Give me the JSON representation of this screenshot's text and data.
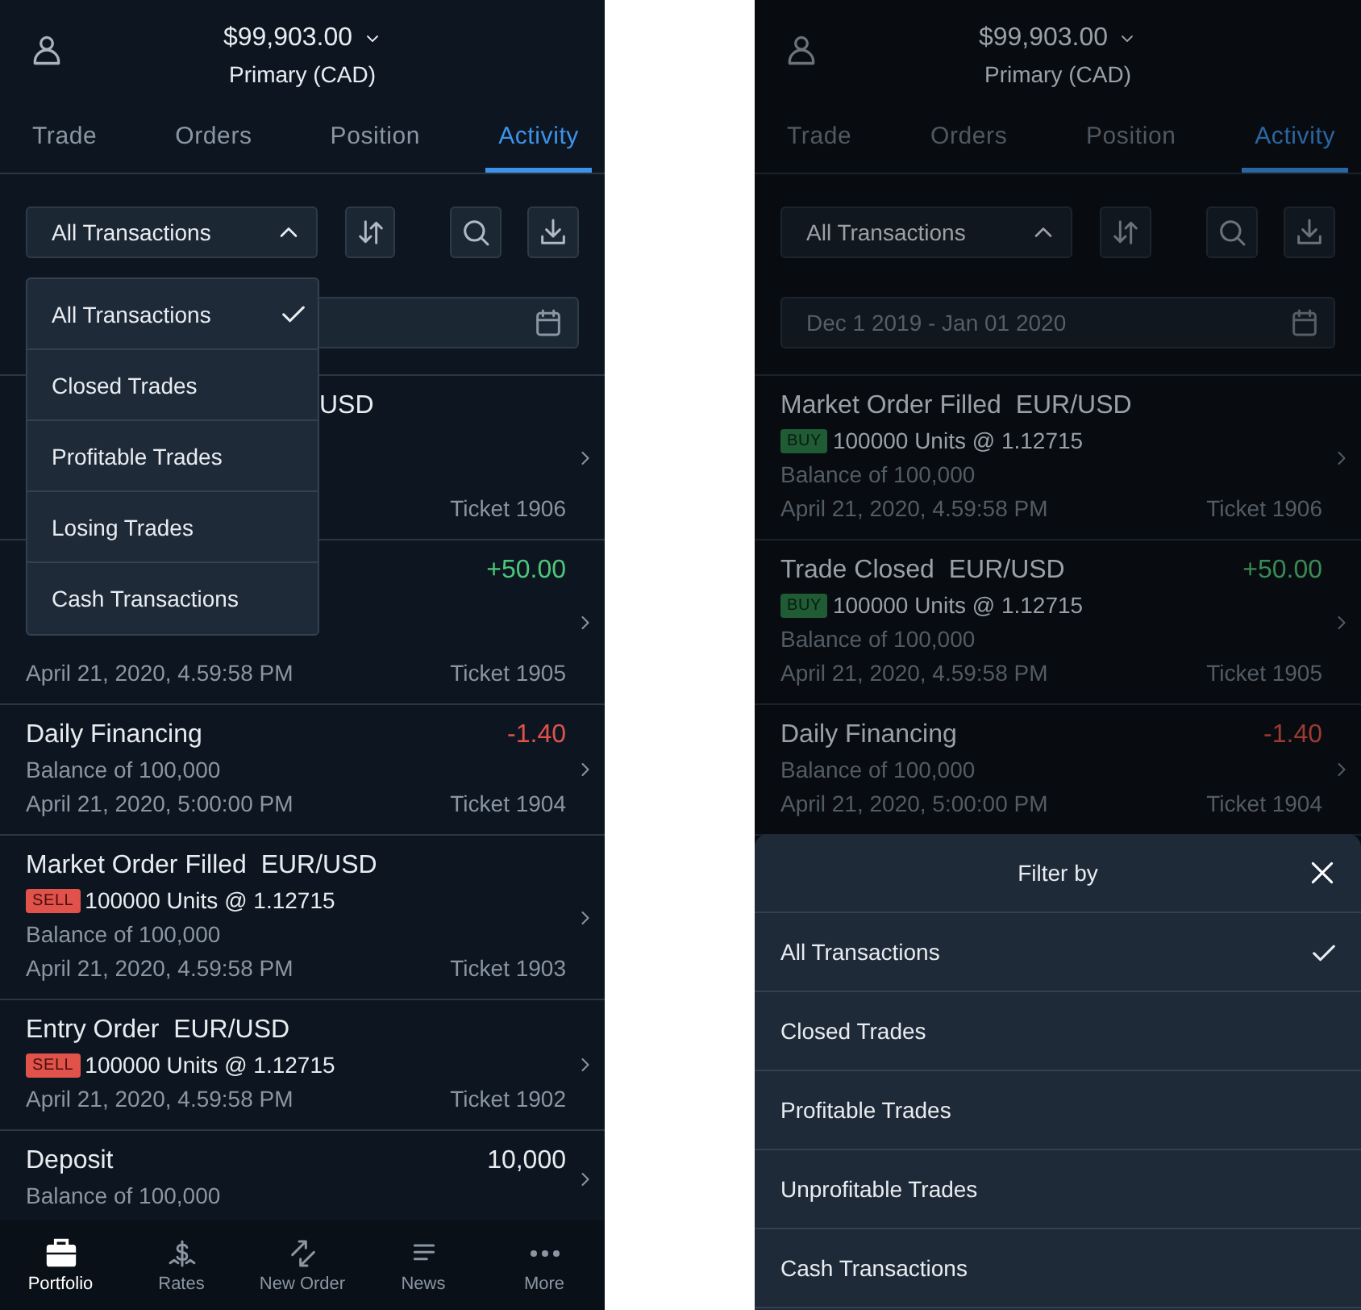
{
  "left_screen": {
    "header": {
      "balance": "$99,903.00",
      "account": "Primary (CAD)"
    },
    "tabs": [
      {
        "label": "Trade",
        "selected": false
      },
      {
        "label": "Orders",
        "selected": false
      },
      {
        "label": "Position",
        "selected": false
      },
      {
        "label": "Activity",
        "selected": true
      }
    ],
    "filter": {
      "value": "All Transactions",
      "expanded": true
    },
    "dropdown": {
      "options": [
        {
          "label": "All Transactions",
          "selected": true
        },
        {
          "label": "Closed Trades",
          "selected": false
        },
        {
          "label": "Profitable Trades",
          "selected": false
        },
        {
          "label": "Losing Trades",
          "selected": false
        },
        {
          "label": "Cash Transactions",
          "selected": false
        }
      ]
    },
    "transactions": [
      {
        "title_tail": "USD",
        "ticket": "Ticket 1906"
      },
      {
        "amount": "+50.00",
        "color": "#4cc77a",
        "date": "April 21, 2020, 4.59:58 PM",
        "ticket": "Ticket 1905"
      },
      {
        "title": "Daily Financing",
        "amount": "-1.40",
        "color": "#e0524a",
        "balance": "Balance of 100,000",
        "date": "April 21, 2020, 5:00:00 PM",
        "ticket": "Ticket 1904"
      },
      {
        "title": "Market Order Filled  EUR/USD",
        "side": {
          "kind": "sell",
          "label": "SELL"
        },
        "units": "100000 Units @ 1.12715",
        "balance": "Balance of 100,000",
        "date": "April 21, 2020, 4.59:58 PM",
        "ticket": "Ticket 1903"
      },
      {
        "title": "Entry Order  EUR/USD",
        "side": {
          "kind": "sell",
          "label": "SELL"
        },
        "units": "100000 Units @ 1.12715",
        "date": "April 21, 2020, 4.59:58 PM",
        "ticket": "Ticket 1902"
      },
      {
        "title": "Deposit",
        "amount": "10,000",
        "color": "#e8ecf0",
        "balance": "Balance of 100,000"
      }
    ],
    "bottom_nav": [
      {
        "kind": "portfolio",
        "label": "Portfolio",
        "selected": true
      },
      {
        "kind": "rates",
        "label": "Rates",
        "selected": false
      },
      {
        "kind": "order",
        "label": "New Order",
        "selected": false
      },
      {
        "kind": "news",
        "label": "News",
        "selected": false
      },
      {
        "kind": "more",
        "label": "More",
        "selected": false
      }
    ]
  },
  "right_screen": {
    "header": {
      "balance": "$99,903.00",
      "account": "Primary (CAD)"
    },
    "tabs": [
      {
        "label": "Trade",
        "selected": false
      },
      {
        "label": "Orders",
        "selected": false
      },
      {
        "label": "Position",
        "selected": false
      },
      {
        "label": "Activity",
        "selected": true
      }
    ],
    "filter": {
      "value": "All Transactions",
      "expanded": true
    },
    "date_range": "Dec 1 2019 - Jan 01 2020",
    "transactions": [
      {
        "title": "Market Order Filled  EUR/USD",
        "side": {
          "kind": "buy",
          "label": "BUY"
        },
        "units": "100000 Units @ 1.12715",
        "balance": "Balance of 100,000",
        "date": "April 21, 2020, 4.59:58 PM",
        "ticket": "Ticket 1906"
      },
      {
        "title": "Trade Closed  EUR/USD",
        "amount": "+50.00",
        "color": "#3a8a55",
        "side": {
          "kind": "buy",
          "label": "BUY"
        },
        "units": "100000 Units @ 1.12715",
        "balance": "Balance of 100,000",
        "date": "April 21, 2020, 4.59:58 PM",
        "ticket": "Ticket 1905"
      },
      {
        "title": "Daily Financing",
        "amount": "-1.40",
        "color": "#9c3a33",
        "balance": "Balance of 100,000",
        "date": "April 21, 2020, 5:00:00 PM",
        "ticket": "Ticket 1904"
      }
    ],
    "sheet": {
      "title": "Filter by",
      "options": [
        {
          "label": "All Transactions",
          "selected": true
        },
        {
          "label": "Closed Trades",
          "selected": false
        },
        {
          "label": "Profitable Trades",
          "selected": false
        },
        {
          "label": "Unprofitable Trades",
          "selected": false
        },
        {
          "label": "Cash Transactions",
          "selected": false
        }
      ]
    }
  }
}
